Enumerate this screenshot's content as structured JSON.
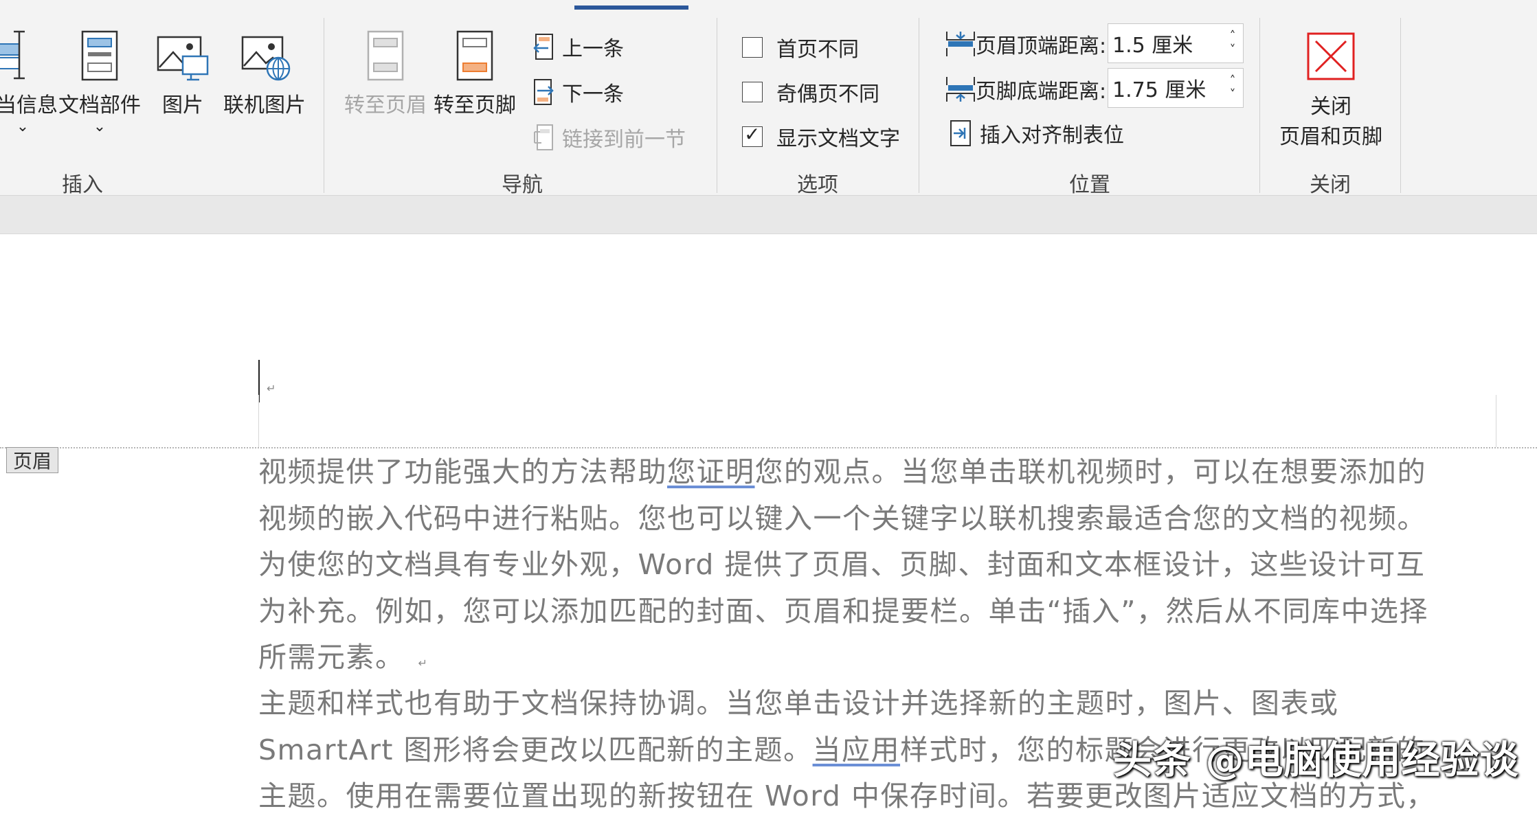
{
  "ribbon": {
    "insert_group": {
      "label": "插入",
      "buttons": [
        {
          "label": "当信息",
          "icon": "document-info-icon"
        },
        {
          "label": "文档部件",
          "icon": "quick-parts-icon"
        },
        {
          "label": "图片",
          "icon": "picture-icon"
        },
        {
          "label": "联机图片",
          "icon": "online-picture-icon"
        }
      ]
    },
    "nav_group": {
      "label": "导航",
      "goto_header": "转至页眉",
      "goto_footer": "转至页脚",
      "previous": "上一条",
      "next": "下一条",
      "link_previous": "链接到前一节"
    },
    "options_group": {
      "label": "选项",
      "first_page_diff": {
        "label": "首页不同",
        "checked": false
      },
      "odd_even_diff": {
        "label": "奇偶页不同",
        "checked": false
      },
      "show_doc_text": {
        "label": "显示文档文字",
        "checked": true
      }
    },
    "position_group": {
      "label": "位置",
      "header_top_label": "页眉顶端距离:",
      "header_top_value": "1.5 厘米",
      "footer_bottom_label": "页脚底端距离:",
      "footer_bottom_value": "1.75 厘米",
      "insert_align_tab": "插入对齐制表位"
    },
    "close_group": {
      "label": "关闭",
      "close_line1": "关闭",
      "close_line2": "页眉和页脚"
    },
    "accent_color": "#2b579a"
  },
  "document": {
    "header_tag": "页眉",
    "paragraphs": [
      {
        "line1_a": "视频提供了功能强大的方法帮助",
        "line1_link": "您证明",
        "line1_b": "您的观点。当您单击联机视频时，可以在想要添加的",
        "line2": "视频的嵌入代码中进行粘贴。您也可以键入一个关键字以联机搜索最适合您的文档的视频。",
        "line3": "为使您的文档具有专业外观，Word 提供了页眉、页脚、封面和文本框设计，这些设计可互",
        "line4": "为补充。例如，您可以添加匹配的封面、页眉和提要栏。单击“插入”，然后从不同库中选择",
        "line5": "所需元素。"
      },
      {
        "line1": "主题和样式也有助于文档保持协调。当您单击设计并选择新的主题时，图片、图表或",
        "line2_a": "SmartArt 图形将会更改以匹配新的主题。",
        "line2_link": "当应用",
        "line2_b": "样式时，您的标题会进行更改以匹配新的",
        "line3": "主题。使用在需要位置出现的新按钮在 Word 中保存时间。若要更改图片适应文档的方式，"
      }
    ],
    "watermark": "头条 @电脑使用经验谈"
  }
}
